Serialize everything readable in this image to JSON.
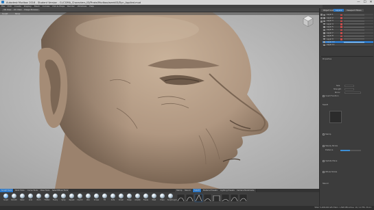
{
  "window": {
    "title": "Autodesk Mudbox 2016 - Student Version - G:/CGMA_Characters_ID/Pirate/Mudbox/week03/Dyn_Applied.mud",
    "minimize": "—",
    "maximize": "☐",
    "close": "✕"
  },
  "menubar": [
    "File",
    "Edit",
    "Create",
    "Display",
    "Mesh",
    "Curves",
    "UVs & Maps",
    "Render",
    "Windows",
    "Help"
  ],
  "shelf": {
    "buttons": [
      "3D View",
      "UV View",
      "Image Browser"
    ]
  },
  "viewport": {
    "header_left": "Sculpt",
    "header_right": "Persp"
  },
  "panel": {
    "tabs": [
      "Object List",
      "Layers",
      "Viewport Filters"
    ],
    "active_tab": "Layers",
    "layers": [
      {
        "name": "Layer 1",
        "selected": false
      },
      {
        "name": "Layer 2",
        "selected": false
      },
      {
        "name": "Layer 3",
        "selected": false
      },
      {
        "name": "Layer 4",
        "selected": false
      },
      {
        "name": "Layer 5",
        "selected": false
      },
      {
        "name": "Layer 6",
        "selected": false
      },
      {
        "name": "Layer 7",
        "selected": false
      },
      {
        "name": "Layer 8",
        "selected": false
      },
      {
        "name": "Layer 9",
        "selected": false
      },
      {
        "name": "Layer 10",
        "selected": true
      },
      {
        "name": "Layer 11",
        "selected": false
      }
    ],
    "properties": {
      "size_label": "Size",
      "strength_label": "Strength",
      "mirror_label": "Mirror",
      "falloff_label": "Falloff",
      "stamp_label": "Stamp",
      "stencil_label": "Stencil",
      "invert_label": "Invert Function",
      "steady_label": "Steady Stroke",
      "distance_label": "Distance",
      "update_plane_label": "Update Plane",
      "whole_stroke_label": "Whole Stroke",
      "props_label": "Properties"
    }
  },
  "tray": {
    "tabs": [
      "Sculpt Tools",
      "Paint Tools",
      "Curve Tools",
      "Pose Tools",
      "Select/Move Tools"
    ],
    "right_tabs": [
      "Stamp",
      "Stencil",
      "Falloff",
      "Material Presets",
      "Lighting Presets",
      "Camera Bookmarks"
    ],
    "tools": [
      "Sculpt",
      "Smooth",
      "Relax",
      "Grab",
      "Pinch",
      "Flatten",
      "Foamy",
      "Spray",
      "Repeat",
      "Imprint",
      "Wax",
      "Scrape",
      "Fill",
      "Knife",
      "Smear",
      "Bulge",
      "Amplify",
      "Freeze",
      "Mask",
      "Erase",
      "Sculpt Layer"
    ]
  },
  "statusbar": {
    "text": "Total: 5,408,000  GPU Mem: 1,568 MB  Active: 10 / 11  FPS: 39.11"
  },
  "colors": {
    "accent": "#2e79c7",
    "viewport_bg": "#b9b9b9",
    "clay": "#b59d84"
  }
}
